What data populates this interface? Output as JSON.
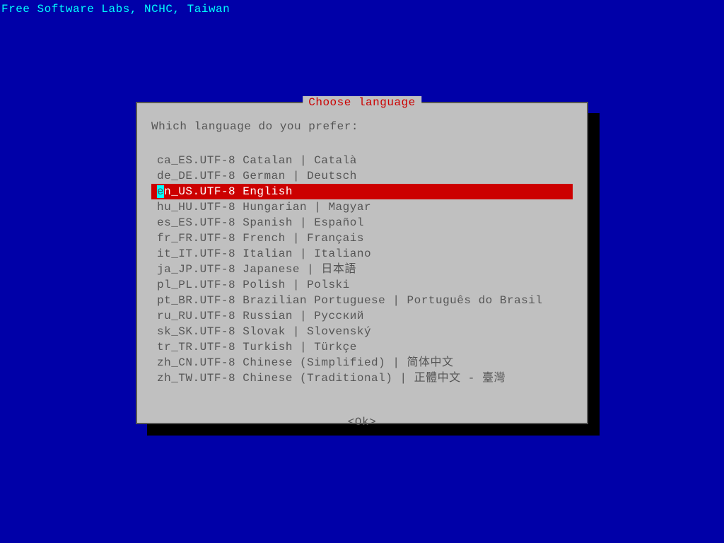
{
  "header": "Free Software Labs, NCHC, Taiwan",
  "dialog": {
    "title": "Choose language",
    "prompt": "Which language do you prefer:",
    "ok_label": "<Ok>",
    "selected_index": 2,
    "items": [
      {
        "label": "ca_ES.UTF-8 Catalan | Català"
      },
      {
        "label": "de_DE.UTF-8 German | Deutsch"
      },
      {
        "label": "en_US.UTF-8 English"
      },
      {
        "label": "hu_HU.UTF-8 Hungarian | Magyar"
      },
      {
        "label": "es_ES.UTF-8 Spanish | Español"
      },
      {
        "label": "fr_FR.UTF-8 French | Français"
      },
      {
        "label": "it_IT.UTF-8 Italian | Italiano"
      },
      {
        "label": "ja_JP.UTF-8 Japanese | 日本語"
      },
      {
        "label": "pl_PL.UTF-8 Polish | Polski"
      },
      {
        "label": "pt_BR.UTF-8 Brazilian Portuguese | Português do Brasil"
      },
      {
        "label": "ru_RU.UTF-8 Russian | Русский"
      },
      {
        "label": "sk_SK.UTF-8 Slovak | Slovenský"
      },
      {
        "label": "tr_TR.UTF-8 Turkish | Türkçe"
      },
      {
        "label": "zh_CN.UTF-8 Chinese (Simplified) | 简体中文"
      },
      {
        "label": "zh_TW.UTF-8 Chinese (Traditional) | 正體中文 - 臺灣"
      }
    ]
  }
}
